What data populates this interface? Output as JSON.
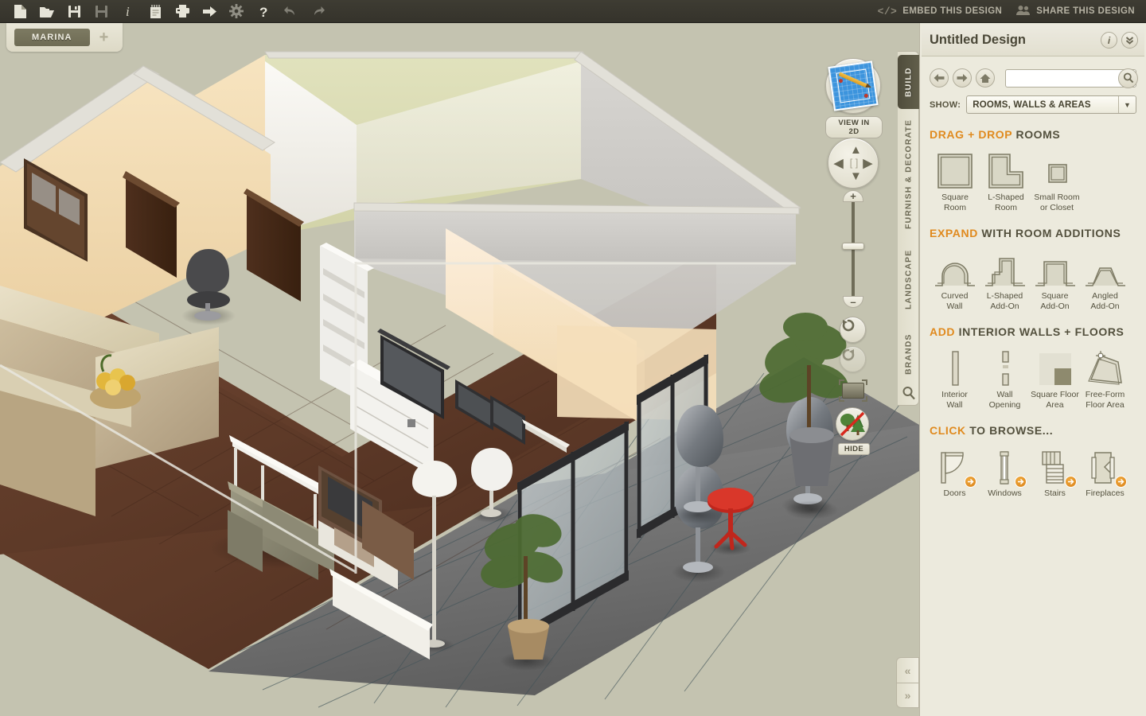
{
  "topbar": {
    "icons": [
      {
        "name": "new-file-icon",
        "title": "New"
      },
      {
        "name": "open-folder-icon",
        "title": "Open"
      },
      {
        "name": "save-icon",
        "title": "Save"
      },
      {
        "name": "save-as-icon",
        "title": "Save As"
      },
      {
        "name": "info-icon",
        "title": "Info"
      },
      {
        "name": "notes-icon",
        "title": "Notes"
      },
      {
        "name": "print-icon",
        "title": "Print"
      },
      {
        "name": "export-icon",
        "title": "Export"
      },
      {
        "name": "settings-gear-icon",
        "title": "Settings"
      },
      {
        "name": "help-icon",
        "title": "Help"
      },
      {
        "name": "undo-icon",
        "title": "Undo"
      },
      {
        "name": "redo-icon",
        "title": "Redo"
      }
    ],
    "embed_label": "EMBED THIS DESIGN",
    "embed_glyph": "</>",
    "share_label": "SHARE THIS DESIGN"
  },
  "tabs": {
    "documents": [
      "MARINA"
    ],
    "add_label": "+"
  },
  "viewport": {
    "view_2d_label": "VIEW IN 2D",
    "hide_label": "HIDE",
    "nav_up": "⌃",
    "nav_down": "⌄",
    "nav_left": "‹",
    "nav_right": "›",
    "nav_center": "[ ]",
    "zoom_in": "+",
    "zoom_out": "–"
  },
  "category_tabs": [
    {
      "label": "BUILD",
      "active": true
    },
    {
      "label": "FURNISH & DECORATE",
      "active": false
    },
    {
      "label": "LANDSCAPE",
      "active": false
    },
    {
      "label": "BRANDS",
      "active": false
    }
  ],
  "panel": {
    "title": "Untitled Design",
    "info_glyph": "i",
    "collapse_glyph": "»",
    "nav": {
      "back": "←",
      "forward": "→",
      "home": "⌂"
    },
    "search": {
      "value": "",
      "placeholder": ""
    },
    "show_label": "SHOW:",
    "show_value": "ROOMS, WALLS & AREAS",
    "sections": [
      {
        "highlight": "DRAG + DROP",
        "rest": "ROOMS",
        "items": [
          {
            "icon": "square-room-icon",
            "label": "Square\nRoom"
          },
          {
            "icon": "l-shaped-room-icon",
            "label": "L-Shaped\nRoom"
          },
          {
            "icon": "small-room-icon",
            "label": "Small Room\nor Closet"
          }
        ]
      },
      {
        "highlight": "EXPAND",
        "rest": "WITH ROOM ADDITIONS",
        "items": [
          {
            "icon": "curved-wall-icon",
            "label": "Curved\nWall"
          },
          {
            "icon": "l-shaped-addon-icon",
            "label": "L-Shaped\nAdd-On"
          },
          {
            "icon": "square-addon-icon",
            "label": "Square\nAdd-On"
          },
          {
            "icon": "angled-addon-icon",
            "label": "Angled\nAdd-On"
          }
        ]
      },
      {
        "highlight": "ADD",
        "rest": "INTERIOR WALLS + FLOORS",
        "items": [
          {
            "icon": "interior-wall-icon",
            "label": "Interior\nWall"
          },
          {
            "icon": "wall-opening-icon",
            "label": "Wall\nOpening"
          },
          {
            "icon": "square-floor-area-icon",
            "label": "Square Floor\nArea"
          },
          {
            "icon": "free-form-floor-area-icon",
            "label": "Free-Form\nFloor Area"
          }
        ]
      },
      {
        "highlight": "CLICK",
        "rest": "TO BROWSE...",
        "items": [
          {
            "icon": "doors-icon",
            "label": "Doors",
            "badge": true
          },
          {
            "icon": "windows-icon",
            "label": "Windows",
            "badge": true
          },
          {
            "icon": "stairs-icon",
            "label": "Stairs",
            "badge": true
          },
          {
            "icon": "fireplaces-icon",
            "label": "Fireplaces",
            "badge": true
          }
        ]
      }
    ]
  },
  "collapse": {
    "left": "«",
    "right": "»"
  },
  "colors": {
    "accent_orange": "#e08a1e",
    "panel_bg": "#eceadd",
    "toolbar_dark": "#3e3c33",
    "canvas_bg": "#c4c3b0",
    "tab_active": "#6e6b54"
  }
}
